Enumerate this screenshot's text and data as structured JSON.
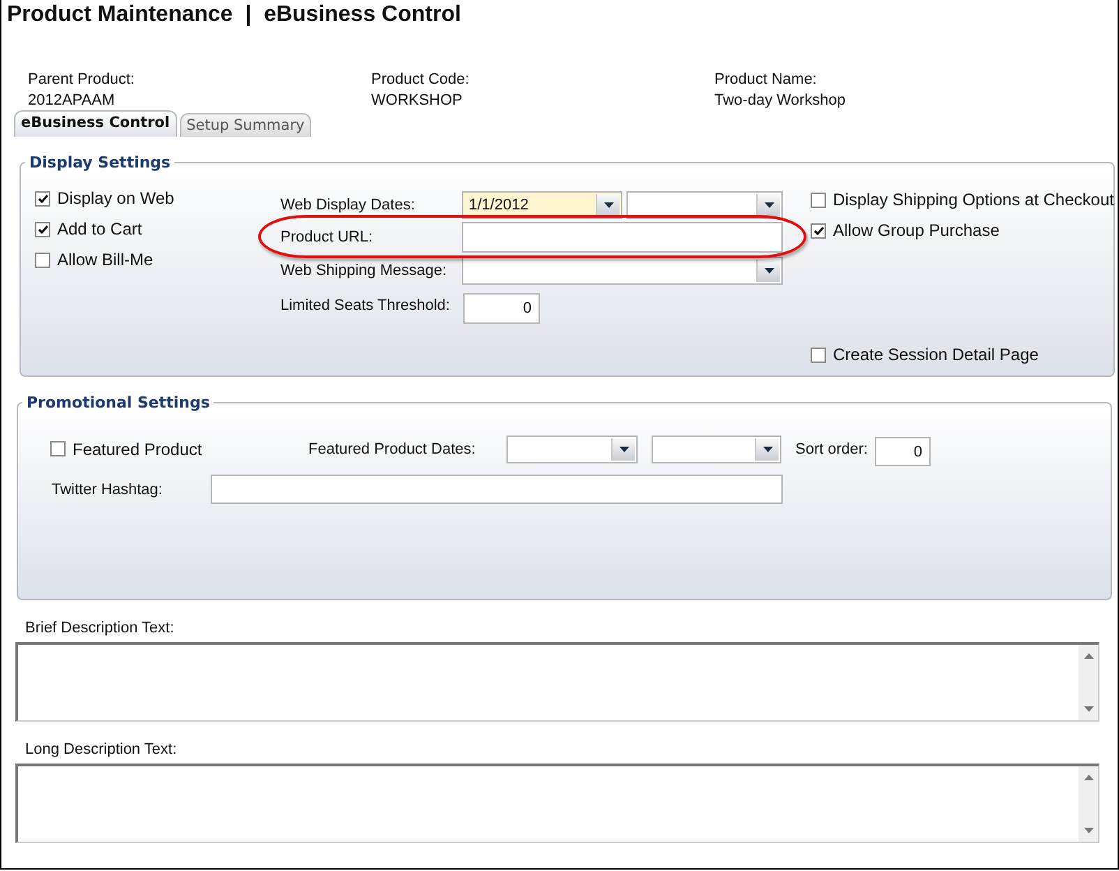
{
  "title": "Product Maintenance  |  eBusiness Control",
  "header_fields": [
    {
      "label": "Parent Product:",
      "value": "2012APAAM"
    },
    {
      "label": "Product Code:",
      "value": "WORKSHOP"
    },
    {
      "label": "Product Name:",
      "value": "Two-day Workshop"
    }
  ],
  "tabs": [
    {
      "label": "eBusiness Control",
      "selected": true
    },
    {
      "label": "Setup Summary",
      "selected": false
    }
  ],
  "display_settings": {
    "title": "Display Settings",
    "left_checks": [
      {
        "label": "Display on Web",
        "checked": true
      },
      {
        "label": "Add to Cart",
        "checked": true
      },
      {
        "label": "Allow Bill-Me",
        "checked": false
      }
    ],
    "rows": [
      {
        "kind": "date_range",
        "label": "Web Display Dates:",
        "fields": [
          {
            "value": "1/1/2012",
            "highlighted": true
          },
          {
            "highlighted": false
          }
        ]
      },
      {
        "kind": "text",
        "label": "Product URL:"
      },
      {
        "kind": "dropdown",
        "label": "Web Shipping Message:"
      },
      {
        "kind": "number",
        "label": "Limited Seats Threshold:",
        "value": "0"
      }
    ],
    "right_checks": [
      {
        "label": "Display Shipping Options at Checkout",
        "checked": false
      },
      {
        "label": "Allow Group Purchase",
        "checked": true
      }
    ],
    "bottom_check": {
      "label": "Create Session Detail Page",
      "checked": false
    }
  },
  "promotional_settings": {
    "title": "Promotional Settings",
    "featured": {
      "label": "Featured Product",
      "checked": false
    },
    "dates_label": "Featured Product Dates:",
    "sort_label": "Sort order:",
    "sort_value": "0",
    "hashtag_label": "Twitter Hashtag:"
  },
  "descriptions": [
    {
      "label": "Brief Description Text:"
    },
    {
      "label": "Long Description Text:"
    }
  ]
}
